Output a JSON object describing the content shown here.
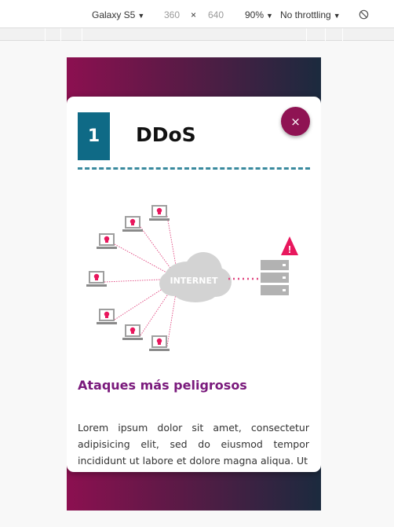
{
  "devtools": {
    "device": "Galaxy S5",
    "width": "360",
    "times": "×",
    "height": "640",
    "zoom": "90%",
    "throttling": "No throttling",
    "rotate_icon": "rotate-icon"
  },
  "card": {
    "number": "1",
    "title": "DDoS",
    "close_label": "×",
    "illustration": {
      "cloud_label": "INTERNET",
      "alert_symbol": "!"
    },
    "subtitle": "Ataques más peligrosos",
    "body": "Lorem ipsum dolor sit amet, consectetur adipisicing elit, sed do eiusmod tempor incididunt ut labore et dolore magna aliqua. Ut"
  },
  "colors": {
    "accent": "#8f1353",
    "number_box": "#0f6a86",
    "subtitle": "#7a1a7c",
    "attack_lines": "#e0447e",
    "alert": "#e8175d"
  }
}
